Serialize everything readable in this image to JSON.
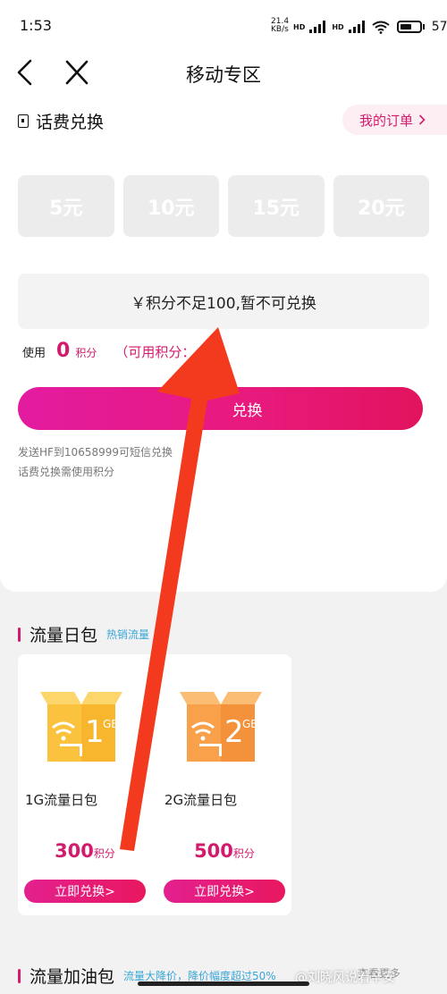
{
  "status_bar": {
    "time": "1:53",
    "net_speed": "21.4",
    "net_unit": "KB/s",
    "hd1": "HD",
    "hd2": "HD",
    "battery": "57"
  },
  "header": {
    "title": "移动专区"
  },
  "recharge": {
    "section_title": "话费兑换",
    "my_orders": "我的订单",
    "amounts": [
      "5元",
      "10元",
      "15元",
      "20元"
    ],
    "notice": "￥积分不足100,暂不可兑换",
    "use_label": "使用",
    "use_points": "0",
    "points_unit": "积分",
    "available": "（可用积分：4",
    "exchange_button": "兑换",
    "hint1": "发送HF到10658999可短信兑换",
    "hint2": "话费兑换需使用积分"
  },
  "flow": {
    "section_title": "流量日包",
    "tag": "热销流量",
    "items": [
      {
        "icon_text": "1",
        "icon_unit": "GB",
        "name": "1G流量日包",
        "points": "300",
        "unit": "积分",
        "button": "立即兑换>"
      },
      {
        "icon_text": "2",
        "icon_unit": "GB",
        "name": "2G流量日包",
        "points": "500",
        "unit": "积分",
        "button": "立即兑换>"
      }
    ]
  },
  "boost": {
    "section_title": "流量加油包",
    "tag": "流量大降价，降价幅度超过50%",
    "more": "查看更多"
  },
  "watermark": "@刘晓风说着辛安",
  "colors": {
    "accent": "#d31b6d",
    "gradient_start": "#e31ba0",
    "gradient_end": "#e2135e",
    "annotation_arrow": "#f43a1e",
    "box_1g": "#fbc33d",
    "box_2g": "#f8a04a",
    "tag_blue": "#3aa6d8"
  }
}
